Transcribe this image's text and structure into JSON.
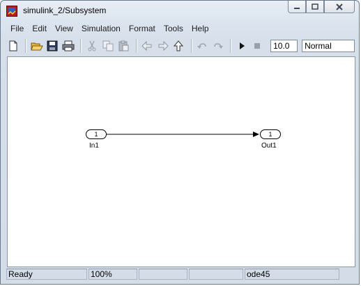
{
  "window": {
    "title": "simulink_2/Subsystem"
  },
  "menu": [
    "File",
    "Edit",
    "View",
    "Simulation",
    "Format",
    "Tools",
    "Help"
  ],
  "toolbar": {
    "stop_time": "10.0",
    "sim_mode": "Normal"
  },
  "blocks": {
    "in1": {
      "port_number": "1",
      "label": "In1"
    },
    "out1": {
      "port_number": "1",
      "label": "Out1"
    }
  },
  "status": {
    "state": "Ready",
    "zoom": "100%",
    "solver": "ode45"
  }
}
